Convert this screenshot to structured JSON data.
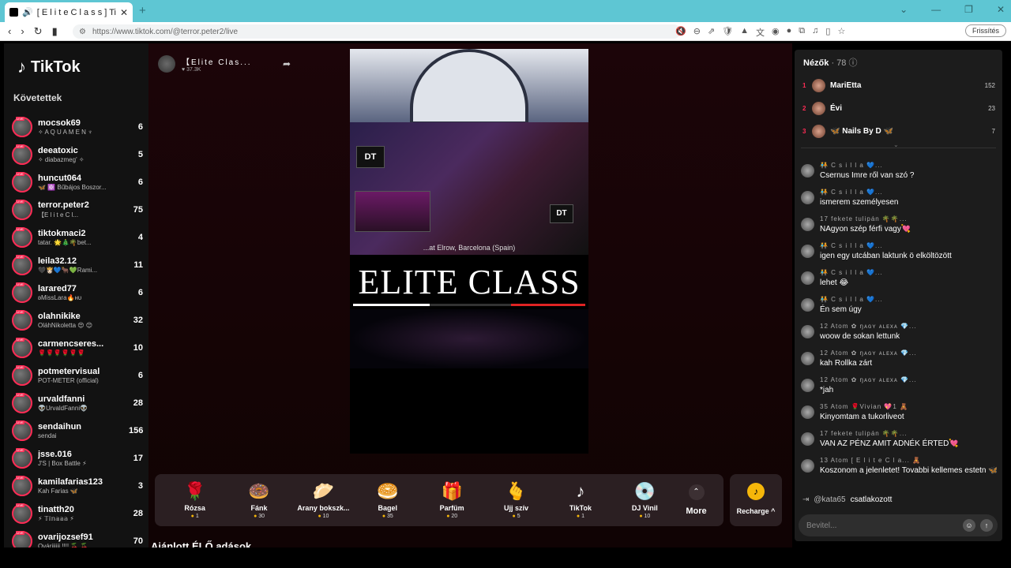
{
  "browser": {
    "tab_title": "[ E l i t e   C l a s s ] Ti",
    "url": "https://www.tiktok.com/@terror.peter2/live",
    "refresh_label": "Frissítés"
  },
  "sidebar": {
    "logo": "TikTok",
    "follow_heading": "Követettek",
    "follows": [
      {
        "user": "mocsok69",
        "sub": "✧ A Q U A M E N ♆",
        "count": "6"
      },
      {
        "user": "deeatoxic",
        "sub": "✧ diabazmeg' ✧",
        "count": "5"
      },
      {
        "user": "huncut064",
        "sub": "🦋 ⚛️ Bűbájos Boszor...",
        "count": "6"
      },
      {
        "user": "terror.peter2",
        "sub": "【E l i t e   C l...",
        "count": "75"
      },
      {
        "user": "tiktokmaci2",
        "sub": "tatar. 🌟🎄🌴bet...",
        "count": "4"
      },
      {
        "user": "leila32.12",
        "sub": "🖤👸🏻💙🐂💚Rami...",
        "count": "11"
      },
      {
        "user": "larared77",
        "sub": "ʚMissLara🔥ʜᴜ",
        "count": "6"
      },
      {
        "user": "olahnikike",
        "sub": "OláhNikoletta 😍 😊",
        "count": "32"
      },
      {
        "user": "carmencseres...",
        "sub": "🌹🌹🌹🌹🌹🌹",
        "count": "10"
      },
      {
        "user": "potmetervisual",
        "sub": "POT-METER (official)",
        "count": "6"
      },
      {
        "user": "urvaldfanni",
        "sub": "👽UrvaldFanni👽",
        "count": "28"
      },
      {
        "user": "sendaihun",
        "sub": "sendai",
        "count": "156"
      },
      {
        "user": "jsse.016",
        "sub": "J'S | Box Battle ⚡",
        "count": "17"
      },
      {
        "user": "kamilafarias123",
        "sub": "Kah Farias 🦋",
        "count": "3"
      },
      {
        "user": "tinatth20",
        "sub": "⚡ 𝕋𝕚𝕟𝕒𝕒𝕒 ⚡",
        "count": "28"
      },
      {
        "user": "ovarijozsef91",
        "sub": "Ovárijjjjj !!!! 🍒 🍒",
        "count": "70"
      }
    ]
  },
  "stream": {
    "name": "【Elite Clas...",
    "likes": "37.3K",
    "video_title": "ELITE CLASS",
    "place": "...at Elrow, Barcelona (Spain)",
    "badge": "DT",
    "recommended": "Ajánlott ÉLŐ adások"
  },
  "gifts": [
    {
      "icon": "🌹",
      "name": "Rózsa",
      "price": "1"
    },
    {
      "icon": "🍩",
      "name": "Fánk",
      "price": "30"
    },
    {
      "icon": "🥟",
      "name": "Arany bokszk...",
      "price": "10"
    },
    {
      "icon": "🥯",
      "name": "Bagel",
      "price": "35"
    },
    {
      "icon": "🎁",
      "name": "Parfüm",
      "price": "20"
    },
    {
      "icon": "🫰",
      "name": "Ujj szív",
      "price": "5"
    },
    {
      "icon": "♪",
      "name": "TikTok",
      "price": "1"
    },
    {
      "icon": "💿",
      "name": "DJ Vinil",
      "price": "10"
    }
  ],
  "more_label": "More",
  "recharge_label": "Recharge ^",
  "viewers": {
    "heading": "Nézők",
    "count": "· 78 ⓘ",
    "top": [
      {
        "rank": "1",
        "name": "MariEtta",
        "score": "152"
      },
      {
        "rank": "2",
        "name": "Évi",
        "score": "23"
      },
      {
        "rank": "3",
        "name": "🦋 Nails By D 🦋",
        "score": "7"
      }
    ]
  },
  "chat": [
    {
      "name": "🧑‍🤝‍🧑 C s i l l a 💙...",
      "text": "Csernus Imre ről van szó ?"
    },
    {
      "name": "🧑‍🤝‍🧑 C s i l l a 💙...",
      "text": "ismerem személyesen"
    },
    {
      "name": "17 fekete tulipán 🌴🌴...",
      "text": "NAgyon szép férfi vagy💘"
    },
    {
      "name": "🧑‍🤝‍🧑 C s i l l a 💙...",
      "text": "igen egy utcában laktunk ö elköltözött"
    },
    {
      "name": "🧑‍🤝‍🧑 C s i l l a 💙...",
      "text": "lehet 😂"
    },
    {
      "name": "🧑‍🤝‍🧑 C s i l l a 💙...",
      "text": "Én sem úgy"
    },
    {
      "name": "12 Atom ✿ ŋᴀɢʏ ᴀʟᴇxᴀ 💎...",
      "text": "woow de sokan lettunk"
    },
    {
      "name": "12 Atom ✿ ŋᴀɢʏ ᴀʟᴇxᴀ 💎...",
      "text": "kah Rollka zárt"
    },
    {
      "name": "12 Atom ✿ ŋᴀɢʏ ᴀʟᴇxᴀ 💎...",
      "text": "*jah"
    },
    {
      "name": "35 Atom 🌹Vivian 💖1 🧸",
      "text": "Kinyomtam a tukorliveot"
    },
    {
      "name": "17 fekete tulipán 🌴🌴...",
      "text": "VAN AZ PÉNZ AMIT ADNÉK ÉRTED💘"
    },
    {
      "name": "13 Atom [ E l i t e C l a... 🧸",
      "text": "Koszonom a jelenletet! Tovabbi kellemes estetn 🦋 Ma is bomba volt a csapat. 🎇"
    }
  ],
  "joined": {
    "name": "@kata65",
    "text": "csatlakozott"
  },
  "input": {
    "placeholder": "Bevitel..."
  }
}
